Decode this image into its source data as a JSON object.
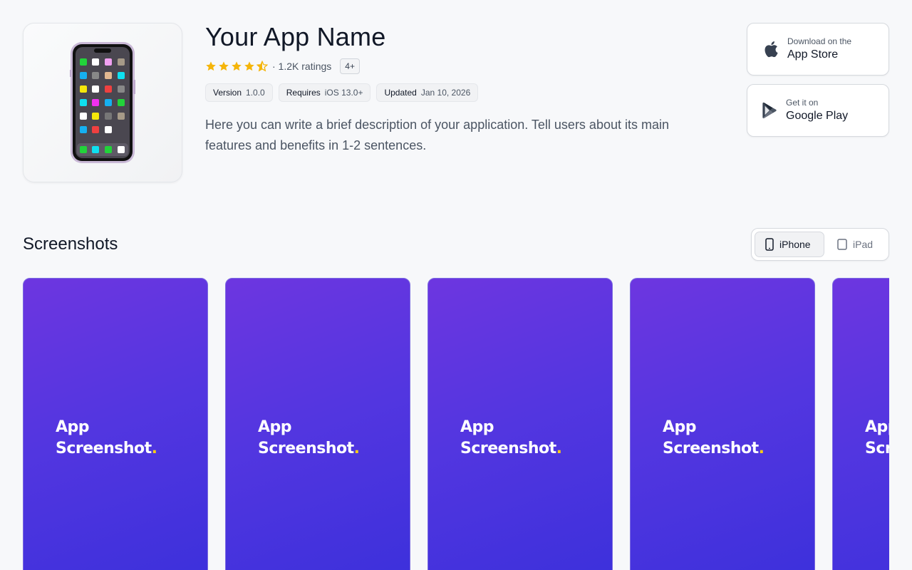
{
  "app": {
    "title": "Your App Name",
    "rating_count": "· 1.2K ratings",
    "rating_value": 4.5,
    "age_rating": "4+",
    "meta": [
      {
        "key": "Version",
        "value": "1.0.0"
      },
      {
        "key": "Requires",
        "value": "iOS 13.0+"
      },
      {
        "key": "Updated",
        "value": "Jan 10, 2026"
      }
    ],
    "description": "Here you can write a brief description of your application. Tell users about its main features and benefits in 1-2 sentences.",
    "icon": "iphone-home-screen-icon"
  },
  "stores": {
    "app_store": {
      "small": "Download on the",
      "big": "App Store",
      "icon": "apple-icon"
    },
    "google_play": {
      "small": "Get it on",
      "big": "Google Play",
      "icon": "google-play-icon"
    }
  },
  "screenshots": {
    "title": "Screenshots",
    "toggle": {
      "iphone": "iPhone",
      "ipad": "iPad",
      "selected": "iPhone"
    },
    "items": [
      {
        "line1": "App",
        "line2": "Screenshot",
        "dot": "."
      },
      {
        "line1": "App",
        "line2": "Screenshot",
        "dot": "."
      },
      {
        "line1": "App",
        "line2": "Screenshot",
        "dot": "."
      },
      {
        "line1": "App",
        "line2": "Screenshot",
        "dot": "."
      },
      {
        "line1": "App",
        "line2": "Screenshot",
        "dot": "."
      }
    ]
  },
  "colors": {
    "star": "#f5b50a",
    "gradient_start": "#6d36e0",
    "gradient_end": "#3b30db",
    "accent_dot": "#facc15"
  }
}
